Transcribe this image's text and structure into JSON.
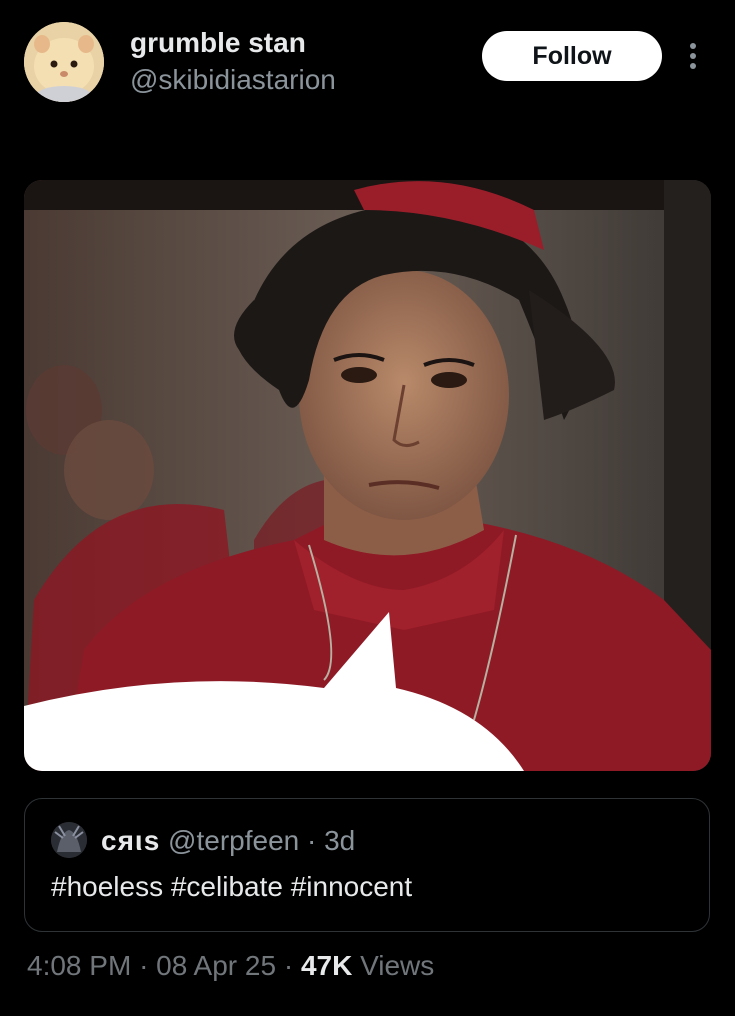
{
  "author": {
    "display_name": "grumble stan",
    "handle": "@skibidiastarion",
    "avatar_icon": "hamster-avatar"
  },
  "actions": {
    "follow_label": "Follow",
    "more_icon": "more-vertical-icon"
  },
  "media": {
    "description_icon": "cardinal-photo-with-speech-bubble"
  },
  "quoted_post": {
    "display_name": "cяιs",
    "handle": "@terpfeen",
    "separator": "·",
    "age": "3d",
    "text": "#hoeless #celibate #innocent"
  },
  "footer": {
    "time": "4:08 PM",
    "separator1": "·",
    "date": "08 Apr 25",
    "separator2": "·",
    "views_count": "47K",
    "views_label": "Views"
  },
  "colors": {
    "background": "#000000",
    "text_primary": "#e7e9ea",
    "text_secondary": "#71767b",
    "follow_bg": "#ffffff",
    "border": "#2f3336"
  }
}
